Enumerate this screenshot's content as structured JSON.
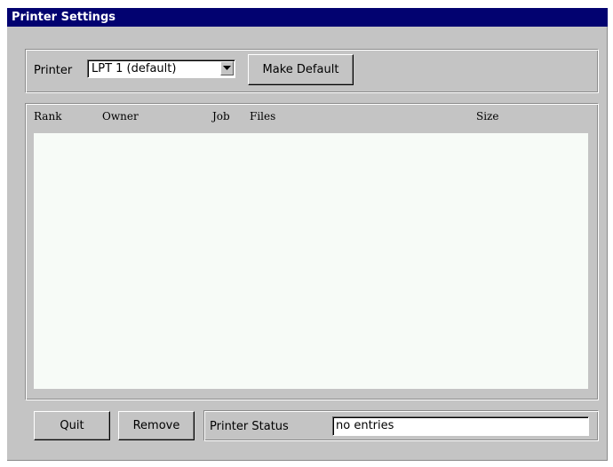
{
  "window": {
    "title": "Printer Settings"
  },
  "printer_bar": {
    "printer_label": "Printer",
    "selected_printer": "LPT 1 (default)",
    "make_default_label": "Make Default"
  },
  "queue": {
    "columns": [
      "Rank",
      "Owner",
      "Job",
      "Files",
      "Size"
    ],
    "rows": []
  },
  "footer": {
    "quit_label": "Quit",
    "remove_label": "Remove",
    "status_label": "Printer Status",
    "status_value": "no entries"
  },
  "colors": {
    "titlebar": "#020270",
    "window_bg": "#c4c4c4",
    "list_bg": "#f7fbf7"
  },
  "icons": {
    "combo_arrow": "chevron-down-icon"
  }
}
